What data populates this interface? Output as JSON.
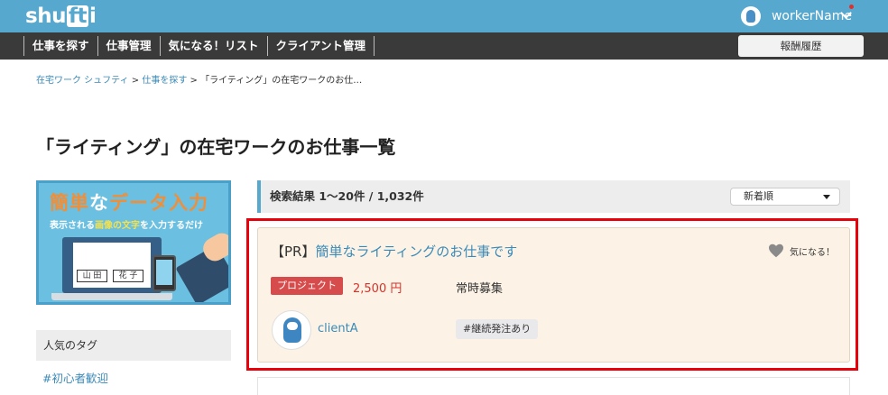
{
  "header": {
    "logo": {
      "part1": "shu",
      "part2": "ft",
      "part3": "i"
    },
    "username": "workerName"
  },
  "nav": {
    "items": [
      {
        "label": "仕事を探す"
      },
      {
        "label": "仕事管理"
      },
      {
        "label": "気になる！リスト"
      },
      {
        "label": "クライアント管理"
      }
    ],
    "history_button": "報酬履歴"
  },
  "breadcrumb": {
    "home": "在宅ワーク シュフティ",
    "sep1": " > ",
    "search": "仕事を探す",
    "sep2": " > ",
    "current": "「ライティング」の在宅ワークのお仕…"
  },
  "page_title": "「ライティング」の在宅ワークのお仕事一覧",
  "sidebar": {
    "banner": {
      "title_part1": "簡単",
      "title_part2": "な",
      "title_part3": "データ入力",
      "subtitle_part1": "表示される",
      "subtitle_part2": "画像の文字",
      "subtitle_part3": "を入力するだけ",
      "field1": "山 田",
      "field2": "花 子"
    },
    "tags_heading": "人気のタグ",
    "tags": [
      {
        "label": "#初心者歓迎"
      }
    ]
  },
  "results": {
    "summary": "検索結果  1〜20件 / 1,032件",
    "sort_selected": "新着順"
  },
  "job_card": {
    "pr_prefix": "【PR】",
    "title": "簡単なライティングのお仕事です",
    "favorite_label": "気になる！",
    "type_badge": "プロジェクト",
    "price": "2,500 円",
    "recruitment": "常時募集",
    "client_name": "clientA",
    "client_tag": "#継続発注あり"
  },
  "colors": {
    "header_bg": "#57a8cf",
    "nav_bg": "#3a3a3a",
    "link": "#3a8ab8",
    "price": "#d6332b",
    "badge_bg": "#d64c4c",
    "card_bg": "#fcf3e6",
    "highlight": "#e8000b"
  }
}
